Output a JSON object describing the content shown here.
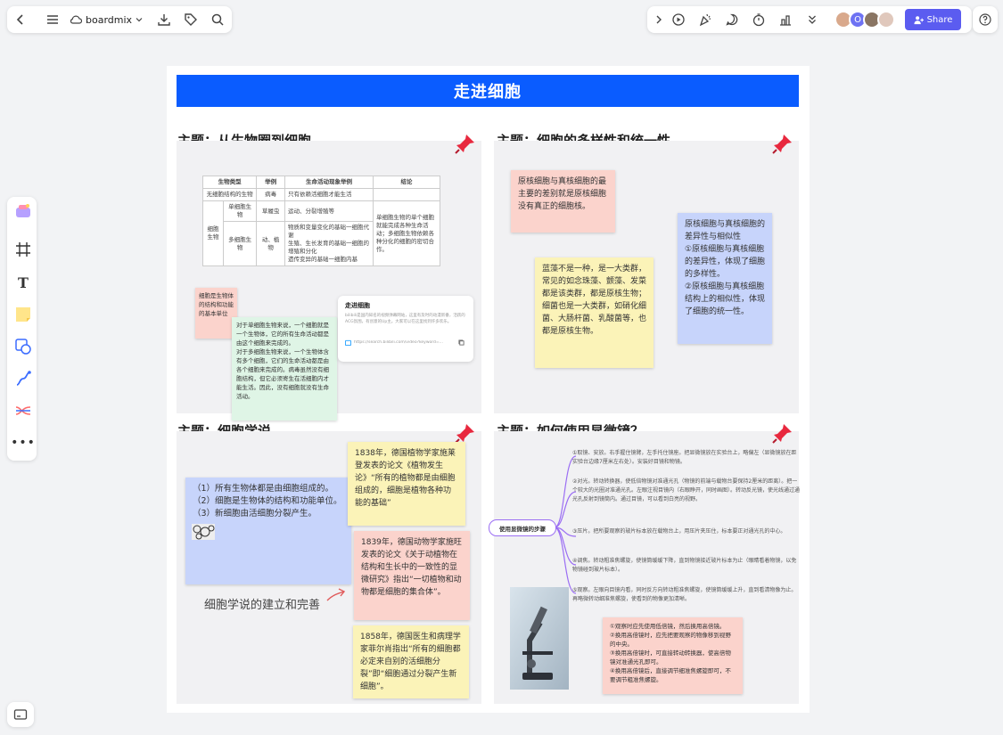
{
  "app": {
    "name": "boardmix"
  },
  "topbar": {
    "share_label": "Share",
    "avatar_initial": "O"
  },
  "board": {
    "banner_title": "走进细胞",
    "q1": {
      "title": "主题：从生物圈到细胞",
      "table": {
        "headers": [
          "生物类型",
          "举例",
          "生命活动现象举例",
          "结论"
        ],
        "row1": [
          "无细胞结构的生物",
          "病毒",
          "只有依赖活细胞才能生活"
        ],
        "group_label": "细胞生物",
        "row2": [
          "单细胞生物",
          "草履虫",
          "运动、分裂增殖等"
        ],
        "row3": [
          "多细胞生物",
          "动、植物",
          "物质和变量变化的基础一细胞代谢\n生殖、生长发育的基础一细胞的增殖和分化\n遗传变异的基础一细胞内基"
        ],
        "conclusion": "单细胞生物的单个细胞就能完成各种生命活动；多细胞生物依赖各种分化的细胞的密切合作。"
      },
      "note_pink": "细胞是生物体的结构和功能的基本单位",
      "note_green": "对于单细胞生物来说，一个细胞就是一个生物体，它的所有生命活动都是由这个细胞来完成的。\n对于多细胞生物来说，一个生物体含有多个细胞，它们的生命活动都是由各个细胞来完成的。病毒虽然没有细胞结构，但它必须寄生在活细胞内才能生活。因此，没有细胞就没有生命活动。",
      "link_card": {
        "title": "走进细胞",
        "desc": "bilibili是国内知名的视频弹幕网站，这里有及时的动漫新番，活跃的ACG氛围，有创意的Up主。大家可以在这里找到许多欢乐。",
        "url": "https://search.bilibili.com/video?keyword=..."
      }
    },
    "q2": {
      "title": "主题：细胞的多样性和统一性",
      "note_pink": "原核细胞与真核细胞的最主要的差别就是原核细胞没有真正的细胞核。",
      "note_yellow": "蓝藻不是一种，是一大类群，常见的如念珠藻、颤藻、发菜都是该类群，都是原核生物；细菌也是一大类群，如硝化细菌、大肠杆菌、乳酸菌等，也都是原核生物。",
      "note_blue": "原核细胞与真核细胞的差异性与相似性\n①原核细胞与真核细胞的差异性，体现了细胞的多样性。\n②原核细胞与真核细胞结构上的相似性，体现了细胞的统一性。"
    },
    "q3": {
      "title": "主题：细胞学说",
      "note_blue": "（1）所有生物体都是由细胞组成的。\n（2）细胞是生物体的结构和功能单位。\n（3）新细胞由活细胞分裂产生。",
      "caption": "细胞学说的建立和完善",
      "note_y1": "1838年，德国植物学家施莱登发表的论文《植物发生论》“所有的植物都是由细胞组成的，细胞是植物各种功能的基础”",
      "note_p1": "1839年，德国动物学家施旺发表的论文《关于动植物在结构和生长中的一致性的显微研究》指出“一切植物和动物都是细胞的集合体”。",
      "note_y2": "1858年，德国医生和病理学家菲尔肖指出“所有的细胞都必定来自别的活细胞分裂”即“细胞通过分裂产生新细胞”。"
    },
    "q4": {
      "title": "主题：如何使用显微镜？",
      "root_label": "使用显微镜的步骤",
      "steps": [
        "①取镜、安放。右手握住镜臂，左手托住镜座。把显微镜放在实验台上，略偏左（显微镜放在距实验台边缘7厘米左右处）。安装好目镜和物镜。",
        "②对光。转动转换器，使低倍物镜对准通光孔（物镜的前端与载物台要保持2厘米的距离）。把一个较大的光圈对准通光孔。左眼注视目镜内（右眼睁开，同时画图）。转动反光镜，使光线通过通光孔反射到镜筒内。通过目镜，可以看到白亮的视野。",
        "③压片。把所要观察的玻片标本放在载物台上，用压片夹压住，标本要正对通光孔的中心。",
        "④调焦。转动粗准焦螺旋，使镜筒缓缓下降，直到物镜接近玻片标本为止（眼睛看着物镜，以免物镜碰到玻片标本）。",
        "⑤观察。左眼向目镜内看，同时反方向转动粗准焦螺旋，使镜筒缓缓上升，直到看清物像为止。再略微转动细准焦螺旋，使看到的物像更加清晰。"
      ],
      "note_pink": "①观察时应先使用低倍镜，然后换用高倍镜。\n②换用高倍镜时，应先把要观察的物像移到视野的中央。\n③换用高倍镜时，可直接转动转换器，使高倍物镜对准通光孔即可。\n④换用高倍镜后，直接调节细准焦螺旋即可，不要调节粗准焦螺旋。"
    }
  },
  "colors": {
    "accent": "#0a5cff",
    "share": "#5b5cf0",
    "pink": "#fbd3cc",
    "yellow": "#fbf3b8",
    "blue": "#c7d4fb",
    "green": "#dff5e6"
  }
}
